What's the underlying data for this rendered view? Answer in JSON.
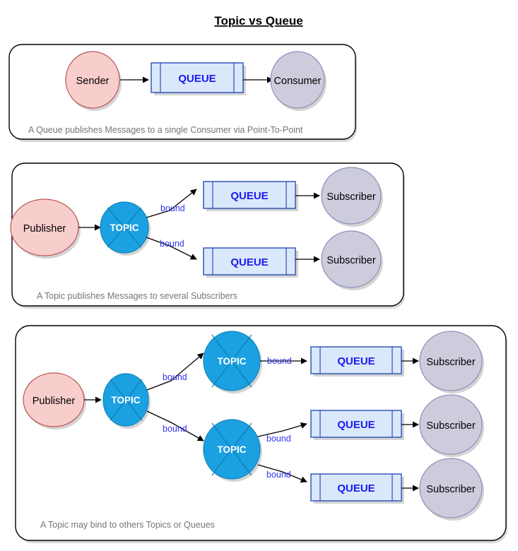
{
  "title": "Topic vs Queue",
  "colors": {
    "producer_fill": "#f8cecc",
    "producer_stroke": "#b85450",
    "consumer_fill": "#ccccdd",
    "consumer_stroke": "#8d8db5",
    "topic_fill": "#1ba1e2",
    "topic_stroke": "#1085bc",
    "queue_fill": "#dae8fc",
    "queue_stroke": "#1a40b0",
    "queue_text": "#1a1aee",
    "bound_text": "#3333ee",
    "caption_text": "#767676",
    "edge": "#000000",
    "panel_stroke": "#000000",
    "page_background": "#ffffff"
  },
  "panels": [
    {
      "id": "panel-queue",
      "caption": "A Queue publishes Messages to a single Consumer via Point-To-Point",
      "nodes": {
        "sender": "Sender",
        "queue": "QUEUE",
        "consumer": "Consumer"
      }
    },
    {
      "id": "panel-topic",
      "caption": "A Topic publishes Messages to several Subscribers",
      "nodes": {
        "publisher": "Publisher",
        "topic": "TOPIC",
        "queue_top": "QUEUE",
        "queue_bottom": "QUEUE",
        "subscriber_top": "Subscriber",
        "subscriber_bottom": "Subscriber"
      },
      "edge_labels": {
        "bound_top": "bound",
        "bound_bottom": "bound"
      }
    },
    {
      "id": "panel-topic-binding",
      "caption": "A Topic may bind to others Topics or Queues",
      "nodes": {
        "publisher": "Publisher",
        "topic_root": "TOPIC",
        "topic_upper": "TOPIC",
        "topic_lower": "TOPIC",
        "queue_1": "QUEUE",
        "queue_2": "QUEUE",
        "queue_3": "QUEUE",
        "subscriber_1": "Subscriber",
        "subscriber_2": "Subscriber",
        "subscriber_3": "Subscriber"
      },
      "edge_labels": {
        "bound_root_upper": "bound",
        "bound_root_lower": "bound",
        "bound_upper_queue": "bound",
        "bound_lower_queue2": "bound",
        "bound_lower_queue3": "bound"
      }
    }
  ]
}
